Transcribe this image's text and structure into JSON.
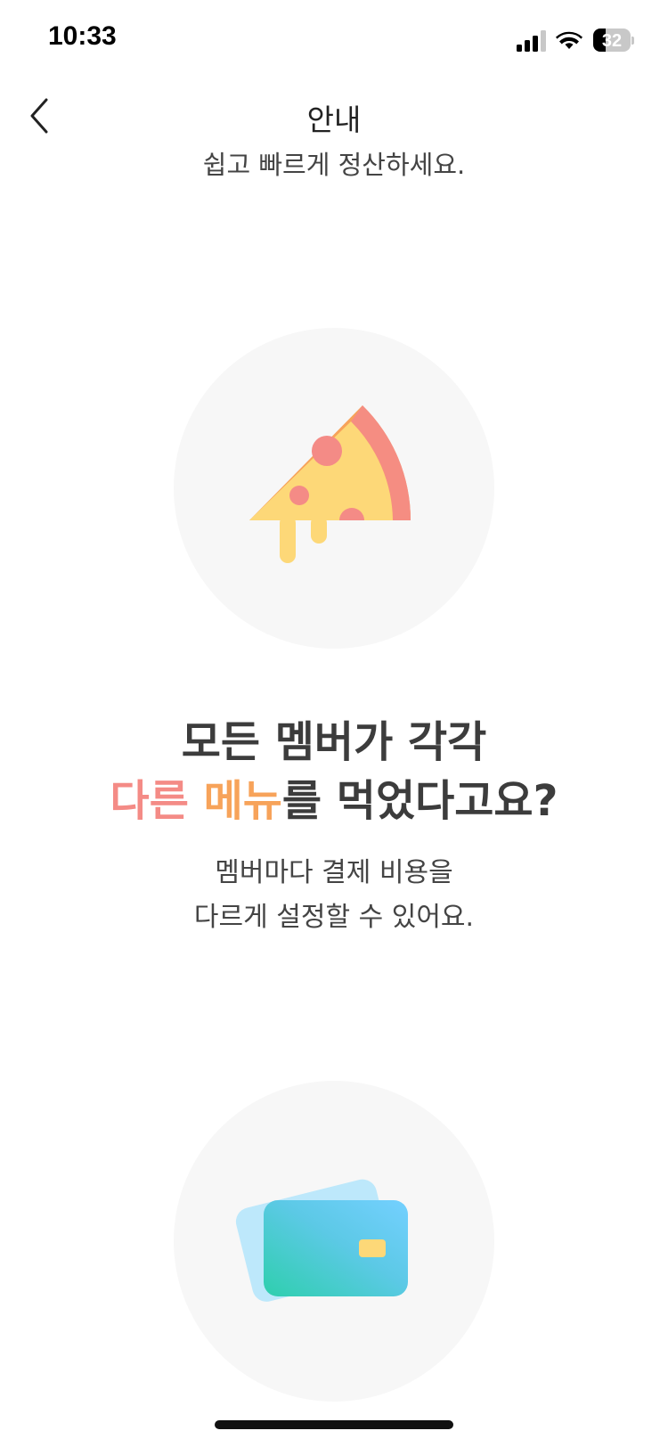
{
  "status_bar": {
    "time": "10:33",
    "battery_level": "32",
    "icons": [
      "signal-icon",
      "wifi-icon",
      "battery-icon"
    ]
  },
  "nav": {
    "title": "안내",
    "back_icon": "chevron-left-icon"
  },
  "partial_previous_text": "쉽고 빠르게 정산하세요.",
  "section": {
    "illustration": "pizza-slice-icon",
    "headline_line1": "모든 멤버가 각각",
    "headline_pink": "다른",
    "headline_orange": "메뉴",
    "headline_rest": "를 먹었다고요?",
    "sub_line1": "멤버마다 결제 비용을",
    "sub_line2": "다르게 설정할 수 있어요."
  },
  "next_section": {
    "illustration": "credit-card-icon"
  },
  "colors": {
    "accent_pink": "#f48b86",
    "accent_orange": "#f7a35a",
    "circle_bg": "#f7f7f7",
    "card_teal": "#2ecfad",
    "card_blue": "#74d0ff"
  }
}
